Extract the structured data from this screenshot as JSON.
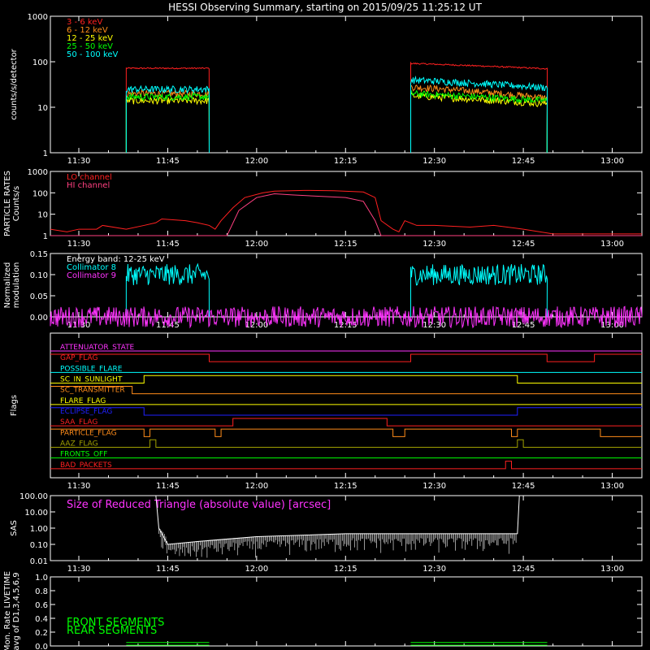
{
  "title": "HESSI Observing Summary, starting on 2015/09/25 11:25:12 UT",
  "time_ticks": [
    "11:30",
    "11:45",
    "12:00",
    "12:15",
    "12:30",
    "12:45",
    "13:00"
  ],
  "colors": {
    "background": "#000000",
    "axis": "#ffffff",
    "red": "#ff2020",
    "orange": "#ff8c1a",
    "yellow": "#ffff00",
    "green": "#00ff00",
    "cyan": "#00ffff",
    "magenta": "#ff33ff",
    "blue": "#2020ff",
    "olive": "#a0a000",
    "pink": "#ff4080",
    "white": "#ffffff"
  },
  "chart_data": [
    {
      "type": "line",
      "ylabel": "counts/s/detector",
      "yscale": "log",
      "ylim": [
        1,
        1000
      ],
      "yticks": [
        "1",
        "10",
        "100",
        "1000"
      ],
      "xlim": [
        "11:25:12",
        "13:05"
      ],
      "legend": "top-left",
      "series": [
        {
          "name": "3 - 6 keV",
          "color": "red",
          "segments": [
            {
              "from": "11:38",
              "to": "11:52",
              "value": 72
            },
            {
              "from": "12:26",
              "to": "12:49",
              "start": 92,
              "end": 70
            }
          ]
        },
        {
          "name": "6 - 12 keV",
          "color": "orange",
          "segments": [
            {
              "from": "11:38",
              "to": "11:52",
              "value": 20
            },
            {
              "from": "12:26",
              "to": "12:49",
              "start": 28,
              "end": 16
            }
          ]
        },
        {
          "name": "12 - 25 keV",
          "color": "yellow",
          "segments": [
            {
              "from": "11:38",
              "to": "11:52",
              "value": 14
            },
            {
              "from": "12:26",
              "to": "12:49",
              "start": 18,
              "end": 12
            }
          ]
        },
        {
          "name": "25 - 50 keV",
          "color": "green",
          "segments": [
            {
              "from": "11:38",
              "to": "11:52",
              "value": 17
            },
            {
              "from": "12:26",
              "to": "12:49",
              "start": 20,
              "end": 14
            }
          ]
        },
        {
          "name": "50 - 100 keV",
          "color": "cyan",
          "segments": [
            {
              "from": "11:38",
              "to": "11:52",
              "value": 25
            },
            {
              "from": "12:26",
              "to": "12:49",
              "start": 40,
              "end": 27
            }
          ]
        }
      ]
    },
    {
      "type": "line",
      "ylabel": "PARTICLE RATES Counts/s",
      "yscale": "log",
      "ylim": [
        1,
        1000
      ],
      "yticks": [
        "1",
        "10",
        "100",
        "1000"
      ],
      "legend": "top-left",
      "series": [
        {
          "name": "LO channel",
          "color": "red",
          "points": [
            [
              "11:25:12",
              2
            ],
            [
              "11:28",
              1.5
            ],
            [
              "11:30",
              2
            ],
            [
              "11:33",
              2
            ],
            [
              "11:34",
              3
            ],
            [
              "11:38",
              2
            ],
            [
              "11:41",
              3
            ],
            [
              "11:43",
              4
            ],
            [
              "11:44",
              6
            ],
            [
              "11:48",
              5
            ],
            [
              "11:50",
              4
            ],
            [
              "11:52",
              3
            ],
            [
              "11:53",
              2
            ],
            [
              "11:54",
              5
            ],
            [
              "11:56",
              20
            ],
            [
              "11:58",
              60
            ],
            [
              "12:01",
              100
            ],
            [
              "12:03",
              120
            ],
            [
              "12:08",
              130
            ],
            [
              "12:13",
              125
            ],
            [
              "12:18",
              110
            ],
            [
              "12:20",
              60
            ],
            [
              "12:21",
              5
            ],
            [
              "12:23",
              2
            ],
            [
              "12:24",
              1.5
            ],
            [
              "12:25",
              5
            ],
            [
              "12:27",
              3
            ],
            [
              "12:30",
              3
            ],
            [
              "12:36",
              2.5
            ],
            [
              "12:40",
              3
            ],
            [
              "12:45",
              2
            ],
            [
              "12:50",
              1.2
            ],
            [
              "13:05",
              1.2
            ]
          ]
        },
        {
          "name": "HI channel",
          "color": "pink",
          "points": [
            [
              "11:25:12",
              1
            ],
            [
              "11:55",
              1
            ],
            [
              "11:57",
              15
            ],
            [
              "12:00",
              60
            ],
            [
              "12:03",
              90
            ],
            [
              "12:06",
              80
            ],
            [
              "12:10",
              70
            ],
            [
              "12:15",
              60
            ],
            [
              "12:18",
              40
            ],
            [
              "12:20",
              5
            ],
            [
              "12:21",
              1
            ],
            [
              "13:05",
              1
            ]
          ]
        }
      ]
    },
    {
      "type": "line",
      "ylabel": "Normalized modulation",
      "ylim": [
        0,
        0.15
      ],
      "yticks": [
        "0.00",
        "0.05",
        "0.10",
        "0.15"
      ],
      "annotation": "Energy band:  12-25 keV",
      "legend": "top-left",
      "series": [
        {
          "name": "Collimator 8",
          "color": "cyan",
          "segments": [
            {
              "from": "11:38",
              "to": "11:52",
              "value": 0.1
            },
            {
              "from": "12:26",
              "to": "12:49",
              "value": 0.1
            }
          ]
        },
        {
          "name": "Collimator 9",
          "color": "magenta",
          "segments": [
            {
              "from": "11:25:12",
              "to": "13:05",
              "value": 0.0
            }
          ]
        }
      ]
    },
    {
      "type": "line",
      "ylabel": "Flags",
      "series": [
        {
          "name": "ATTENUATOR_STATE",
          "color": "magenta",
          "points": [
            [
              "11:25:12",
              0
            ],
            [
              "13:05",
              0
            ]
          ]
        },
        {
          "name": "GAP_FLAG",
          "color": "red",
          "points": [
            [
              "11:25:12",
              1
            ],
            [
              "11:52",
              1
            ],
            [
              "11:52",
              0
            ],
            [
              "12:26",
              0
            ],
            [
              "12:26",
              1
            ],
            [
              "12:49",
              1
            ],
            [
              "12:49",
              0
            ],
            [
              "12:57",
              0
            ],
            [
              "12:57",
              1
            ],
            [
              "13:05",
              1
            ]
          ]
        },
        {
          "name": "POSSIBLE_FLARE",
          "color": "cyan",
          "points": [
            [
              "11:25:12",
              0
            ],
            [
              "13:05",
              0
            ]
          ]
        },
        {
          "name": "SC_IN_SUNLIGHT",
          "color": "yellow",
          "points": [
            [
              "11:25:12",
              0
            ],
            [
              "11:41",
              0
            ],
            [
              "11:41",
              1
            ],
            [
              "12:44",
              1
            ],
            [
              "12:44",
              0
            ],
            [
              "13:05",
              0
            ]
          ]
        },
        {
          "name": "SC_TRANSMITTER",
          "color": "orange",
          "points": [
            [
              "11:25:12",
              1
            ],
            [
              "11:39",
              1
            ],
            [
              "11:39",
              0
            ],
            [
              "13:05",
              0
            ]
          ]
        },
        {
          "name": "FLARE_FLAG",
          "color": "yellow",
          "points": [
            [
              "11:25:12",
              0
            ],
            [
              "13:05",
              0
            ]
          ]
        },
        {
          "name": "ECLIPSE_FLAG",
          "color": "blue",
          "points": [
            [
              "11:25:12",
              1
            ],
            [
              "11:41",
              1
            ],
            [
              "11:41",
              0
            ],
            [
              "12:44",
              0
            ],
            [
              "12:44",
              1
            ],
            [
              "13:05",
              1
            ]
          ]
        },
        {
          "name": "SAA_FLAG",
          "color": "red",
          "points": [
            [
              "11:25:12",
              0
            ],
            [
              "11:56",
              0
            ],
            [
              "11:56",
              1
            ],
            [
              "12:22",
              1
            ],
            [
              "12:22",
              0
            ],
            [
              "13:05",
              0
            ]
          ]
        },
        {
          "name": "PARTICLE_FLAG",
          "color": "orange",
          "points": [
            [
              "11:25:12",
              1
            ],
            [
              "11:41",
              1
            ],
            [
              "11:41",
              0
            ],
            [
              "11:42",
              0
            ],
            [
              "11:42",
              1
            ],
            [
              "11:53",
              1
            ],
            [
              "11:53",
              0
            ],
            [
              "11:54",
              0
            ],
            [
              "11:54",
              1
            ],
            [
              "12:23",
              1
            ],
            [
              "12:23",
              0
            ],
            [
              "12:25",
              0
            ],
            [
              "12:25",
              1
            ],
            [
              "12:43",
              1
            ],
            [
              "12:43",
              0
            ],
            [
              "12:44",
              0
            ],
            [
              "12:44",
              1
            ],
            [
              "12:58",
              1
            ],
            [
              "12:58",
              0
            ],
            [
              "13:05",
              0
            ]
          ]
        },
        {
          "name": "AAZ_FLAG",
          "color": "olive",
          "points": [
            [
              "11:25:12",
              0
            ],
            [
              "11:42",
              0
            ],
            [
              "11:42",
              1
            ],
            [
              "11:43",
              1
            ],
            [
              "11:43",
              0
            ],
            [
              "12:44",
              0
            ],
            [
              "12:44",
              1
            ],
            [
              "12:45",
              1
            ],
            [
              "12:45",
              0
            ],
            [
              "13:05",
              0
            ]
          ]
        },
        {
          "name": "FRONTS_OFF",
          "color": "green",
          "points": [
            [
              "11:25:12",
              0
            ],
            [
              "13:05",
              0
            ]
          ]
        },
        {
          "name": "BAD_PACKETS",
          "color": "red",
          "points": [
            [
              "11:25:12",
              0
            ],
            [
              "12:42",
              0
            ],
            [
              "12:42",
              1
            ],
            [
              "12:43",
              1
            ],
            [
              "12:43",
              0
            ],
            [
              "13:05",
              0
            ]
          ]
        }
      ]
    },
    {
      "type": "line",
      "ylabel": "SAS",
      "yscale": "log",
      "ylim": [
        0.01,
        100
      ],
      "yticks": [
        "0.01",
        "0.10",
        "1.00",
        "10.00",
        "100.00"
      ],
      "annotation": "Size of Reduced Triangle (absolute value) [arcsec]",
      "series": [
        {
          "name": "",
          "color": "white",
          "points": [
            [
              "11:43",
              100
            ],
            [
              "11:43:30",
              1
            ],
            [
              "11:45",
              0.1
            ],
            [
              "11:50",
              0.15
            ],
            [
              "12:00",
              0.3
            ],
            [
              "12:15",
              0.45
            ],
            [
              "12:30",
              0.45
            ],
            [
              "12:44",
              0.45
            ],
            [
              "12:44:20",
              100
            ]
          ]
        }
      ]
    },
    {
      "type": "line",
      "ylabel": "Mon. Rate LIVETIME avg of D1,3,4,5,6,9",
      "ylim": [
        0.0,
        1.0
      ],
      "yticks": [
        "0.0",
        "0.2",
        "0.4",
        "0.6",
        "0.8",
        "1.0"
      ],
      "legend": "bottom-left",
      "series": [
        {
          "name": "FRONT SEGMENTS",
          "color": "green",
          "segments": [
            {
              "from": "11:38",
              "to": "11:52",
              "value": 0.05
            },
            {
              "from": "12:26",
              "to": "12:49",
              "value": 0.05
            }
          ]
        },
        {
          "name": "REAR SEGMENTS",
          "color": "green",
          "segments": [
            {
              "from": "11:38",
              "to": "11:52",
              "value": 0.01
            },
            {
              "from": "12:26",
              "to": "12:49",
              "value": 0.01
            }
          ]
        }
      ]
    }
  ]
}
